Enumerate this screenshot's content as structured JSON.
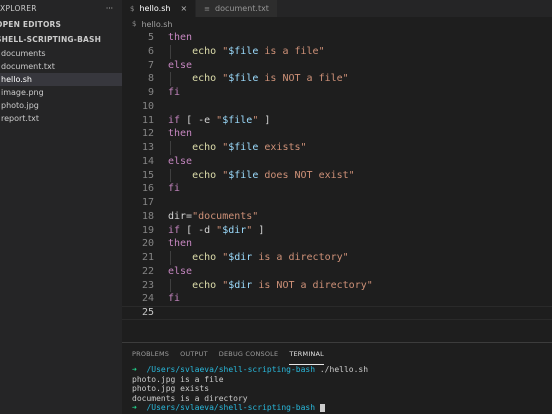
{
  "sidebar": {
    "header": "EXPLORER",
    "more_icon": "ellipsis-icon",
    "open_editors": "OPEN EDITORS",
    "folder": "SHELL-SCRIPTING-BASH",
    "files": [
      "documents",
      "document.txt",
      "hello.sh",
      "image.png",
      "photo.jpg",
      "report.txt"
    ],
    "active_file_index": 2
  },
  "tabs": [
    {
      "label": "hello.sh",
      "icon": "shell-file-icon",
      "active": true,
      "close": "×"
    },
    {
      "label": "document.txt",
      "icon": "text-file-icon",
      "active": false
    }
  ],
  "breadcrumb": {
    "file": "hello.sh"
  },
  "editor": {
    "current_line": 25,
    "lines": [
      {
        "n": "5",
        "code": [
          [
            "kw",
            "then"
          ]
        ]
      },
      {
        "n": "6",
        "code": [
          [
            "",
            "    "
          ],
          [
            "bi",
            "echo"
          ],
          [
            "",
            " "
          ],
          [
            "str",
            "\""
          ],
          [
            "var",
            "$file"
          ],
          [
            "str",
            " is a file\""
          ]
        ]
      },
      {
        "n": "7",
        "code": [
          [
            "kw",
            "else"
          ]
        ]
      },
      {
        "n": "8",
        "code": [
          [
            "",
            "    "
          ],
          [
            "bi",
            "echo"
          ],
          [
            "",
            " "
          ],
          [
            "str",
            "\""
          ],
          [
            "var",
            "$file"
          ],
          [
            "str",
            " is NOT a file\""
          ]
        ]
      },
      {
        "n": "9",
        "code": [
          [
            "kw",
            "fi"
          ]
        ]
      },
      {
        "n": "10",
        "code": []
      },
      {
        "n": "11",
        "code": [
          [
            "kw",
            "if"
          ],
          [
            "",
            " [ -e "
          ],
          [
            "str",
            "\""
          ],
          [
            "var",
            "$file"
          ],
          [
            "str",
            "\""
          ],
          [
            "",
            " ]"
          ]
        ]
      },
      {
        "n": "12",
        "code": [
          [
            "kw",
            "then"
          ]
        ]
      },
      {
        "n": "13",
        "code": [
          [
            "",
            "    "
          ],
          [
            "bi",
            "echo"
          ],
          [
            "",
            " "
          ],
          [
            "str",
            "\""
          ],
          [
            "var",
            "$file"
          ],
          [
            "str",
            " exists\""
          ]
        ]
      },
      {
        "n": "14",
        "code": [
          [
            "kw",
            "else"
          ]
        ]
      },
      {
        "n": "15",
        "code": [
          [
            "",
            "    "
          ],
          [
            "bi",
            "echo"
          ],
          [
            "",
            " "
          ],
          [
            "str",
            "\""
          ],
          [
            "var",
            "$file"
          ],
          [
            "str",
            " does NOT exist\""
          ]
        ]
      },
      {
        "n": "16",
        "code": [
          [
            "kw",
            "fi"
          ]
        ]
      },
      {
        "n": "17",
        "code": []
      },
      {
        "n": "18",
        "code": [
          [
            "",
            "dir="
          ],
          [
            "str",
            "\"documents\""
          ]
        ]
      },
      {
        "n": "19",
        "code": [
          [
            "kw",
            "if"
          ],
          [
            "",
            " [ -d "
          ],
          [
            "str",
            "\""
          ],
          [
            "var",
            "$dir"
          ],
          [
            "str",
            "\""
          ],
          [
            "",
            " ]"
          ]
        ]
      },
      {
        "n": "20",
        "code": [
          [
            "kw",
            "then"
          ]
        ]
      },
      {
        "n": "21",
        "code": [
          [
            "",
            "    "
          ],
          [
            "bi",
            "echo"
          ],
          [
            "",
            " "
          ],
          [
            "str",
            "\""
          ],
          [
            "var",
            "$dir"
          ],
          [
            "str",
            " is a directory\""
          ]
        ]
      },
      {
        "n": "22",
        "code": [
          [
            "kw",
            "else"
          ]
        ]
      },
      {
        "n": "23",
        "code": [
          [
            "",
            "    "
          ],
          [
            "bi",
            "echo"
          ],
          [
            "",
            " "
          ],
          [
            "str",
            "\""
          ],
          [
            "var",
            "$dir"
          ],
          [
            "str",
            " is NOT a directory\""
          ]
        ]
      },
      {
        "n": "24",
        "code": [
          [
            "kw",
            "fi"
          ]
        ]
      },
      {
        "n": "25",
        "code": []
      }
    ]
  },
  "panel": {
    "tabs": [
      "PROBLEMS",
      "OUTPUT",
      "DEBUG CONSOLE",
      "TERMINAL"
    ],
    "active_tab_index": 3,
    "terminal": [
      {
        "arrow": "➜",
        "path": "/Users/svlaeva/shell-scripting-bash",
        "cmd": " ./hello.sh"
      },
      {
        "text": "photo.jpg is a file"
      },
      {
        "text": "photo.jpg exists"
      },
      {
        "text": "documents is a directory"
      },
      {
        "arrow": "➜",
        "path": "/Users/svlaeva/shell-scripting-bash",
        "cmd": " ",
        "cursor": true
      }
    ]
  },
  "colors": {
    "keyword": "#c586c0",
    "builtin": "#dcdcaa",
    "string": "#ce9178",
    "variable": "#9cdcfe",
    "prompt_arrow": "#23d18b",
    "prompt_path": "#29b8db"
  }
}
